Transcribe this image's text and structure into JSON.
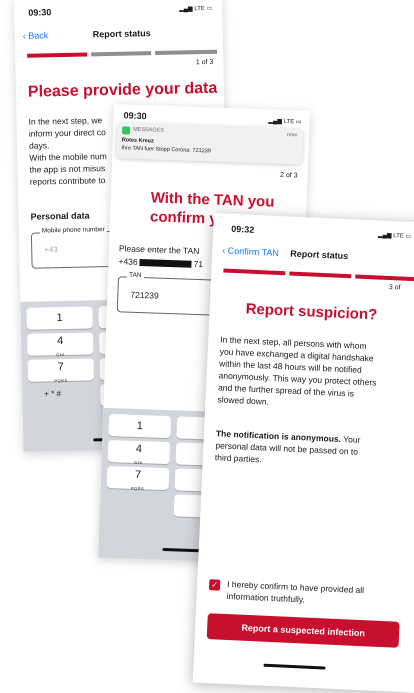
{
  "screen1": {
    "time": "09:30",
    "signal": "LTE",
    "back_label": "Back",
    "nav_title": "Report status",
    "step": "1 of 3",
    "heading": "Please provide your data",
    "text_lines": [
      "In the next step, we",
      "inform your direct co",
      "days.",
      "With the mobile num",
      "the app is not misus",
      "reports contribute to"
    ],
    "section_label": "Personal data",
    "field_label": "Mobile phone number",
    "field_placeholder": "+43",
    "keys": [
      {
        "num": "1",
        "letters": ""
      },
      {
        "num": "4",
        "letters": "GHI"
      },
      {
        "num": "7",
        "letters": "PQRS"
      },
      {
        "num": "+ * #",
        "letters": ""
      }
    ]
  },
  "screen2": {
    "time": "09:30",
    "signal": "LTE",
    "notif_app": "MESSAGES",
    "notif_time": "now",
    "notif_sender": "Rotes Kreuz",
    "notif_body": "Ihre TAN fuer Stopp Corona: 721239",
    "step": "2 of 3",
    "heading_line1": "With the TAN you",
    "heading_line2": "confirm y",
    "prompt": "Please enter the TAN",
    "phone_prefix": "+436",
    "phone_suffix": "71",
    "tan_label": "TAN",
    "tan_value": "721239",
    "keys": [
      {
        "num": "1",
        "letters": ""
      },
      {
        "num": "4",
        "letters": "GHI"
      },
      {
        "num": "7",
        "letters": "PQRS"
      }
    ]
  },
  "screen3": {
    "time": "09:32",
    "signal": "LTE",
    "back_label": "Confirm TAN",
    "nav_title": "Report status",
    "step": "3 of",
    "heading": "Report suspicion?",
    "para1_lines": [
      "In the next step, all persons with whom",
      "you have exchanged a digital handshake",
      "within the last 48 hours will be notified",
      "anonymously. This way you protect others",
      "and the further spread of the virus is",
      "slowed down."
    ],
    "para2_bold": "The notification is anonymous.",
    "para2_rest": " Your",
    "para2_lines": [
      "personal data will not be passed on to",
      "third parties."
    ],
    "consent_line1": "I hereby confirm to have provided all",
    "consent_line2": "information truthfully.",
    "button_label": "Report a suspected infection"
  },
  "colors": {
    "accent": "#c8102e",
    "link": "#0a7aff",
    "segment_inactive": "#8e8e93"
  }
}
